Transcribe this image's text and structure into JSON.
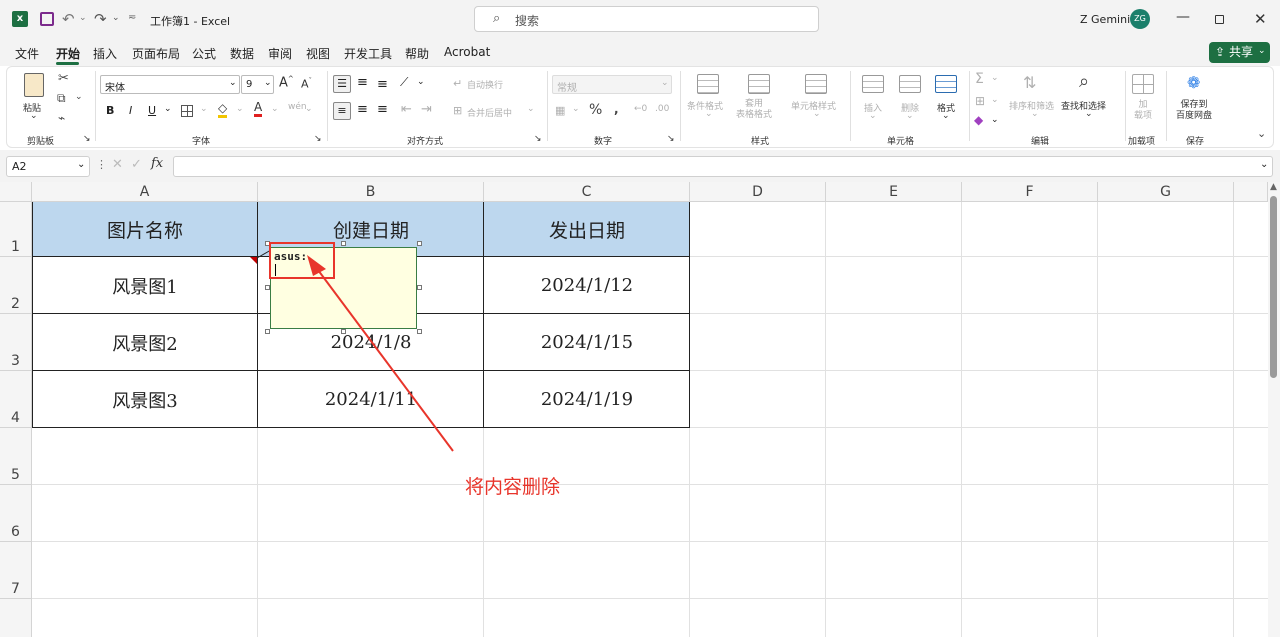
{
  "titlebar": {
    "doc_title": "工作簿1 - Excel",
    "search_placeholder": "搜索",
    "user_name": "Z Gemini",
    "user_initials": "ZG"
  },
  "menu": {
    "items": [
      "文件",
      "开始",
      "插入",
      "页面布局",
      "公式",
      "数据",
      "审阅",
      "视图",
      "开发工具",
      "帮助",
      "Acrobat"
    ],
    "active": "开始",
    "share_label": "共享"
  },
  "ribbon": {
    "clipboard": {
      "paste": "粘贴",
      "group": "剪贴板"
    },
    "font": {
      "name": "宋体",
      "size": "9",
      "bold": "B",
      "italic": "I",
      "underline": "U",
      "group": "字体"
    },
    "alignment": {
      "wrap": "自动换行",
      "merge": "合并后居中",
      "group": "对齐方式"
    },
    "number": {
      "format": "常规",
      "group": "数字"
    },
    "styles": {
      "conditional": "条件格式",
      "table": "套用\n表格格式",
      "cell": "单元格样式",
      "group": "样式"
    },
    "cells": {
      "insert": "插入",
      "delete": "删除",
      "format": "格式",
      "group": "单元格"
    },
    "editing": {
      "sort": "排序和筛选",
      "find": "查找和选择",
      "group": "编辑"
    },
    "addins": {
      "label": "加\n载项",
      "group": "加载项"
    },
    "save": {
      "label": "保存到\n百度网盘",
      "group": "保存"
    }
  },
  "formula_bar": {
    "name_box": "A2",
    "fx": "fx",
    "value": ""
  },
  "sheet": {
    "columns": [
      "A",
      "B",
      "C",
      "D",
      "E",
      "F",
      "G"
    ],
    "rows": [
      "1",
      "2",
      "3",
      "4",
      "5",
      "6",
      "7"
    ],
    "table": [
      [
        "图片名称",
        "创建日期",
        "发出日期"
      ],
      [
        "风景图1",
        "",
        "2024/1/12"
      ],
      [
        "风景图2",
        "2024/1/8",
        "2024/1/15"
      ],
      [
        "风景图3",
        "2024/1/11",
        "2024/1/19"
      ]
    ],
    "header_color": "#bdd7ee",
    "comment_text": "asus:",
    "annotation_text": "将内容删除",
    "annotation_color": "#e8352b"
  }
}
